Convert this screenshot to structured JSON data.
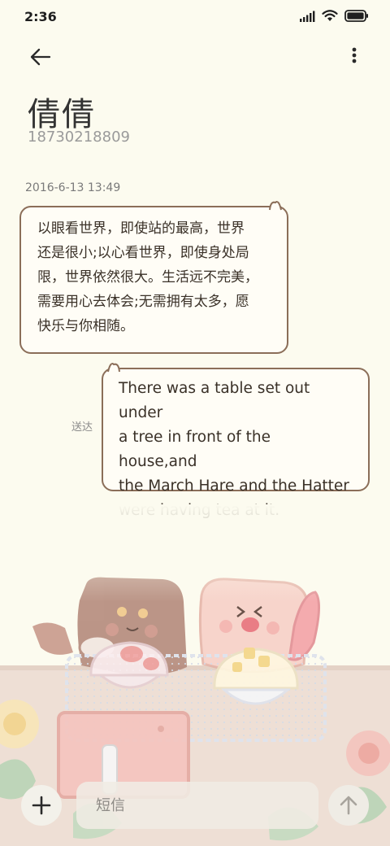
{
  "status_bar": {
    "time": "2:36",
    "icons": [
      "signal-icon",
      "wifi-icon",
      "battery-icon"
    ]
  },
  "header": {
    "back_icon": "arrow-left-icon",
    "more_icon": "more-vertical-icon"
  },
  "contact": {
    "name": "倩倩",
    "phone": "18730218809"
  },
  "conversation": {
    "timestamp": "2016-6-13 13:49",
    "messages": [
      {
        "direction": "incoming",
        "lines": [
          "以眼看世界，即使站的最高，世界",
          "还是很小;以心看世界，即使身处局",
          "限，世界依然很大。生活远不完美，",
          "需要用心去体会;无需拥有太多，愿",
          "快乐与你相随。"
        ]
      },
      {
        "direction": "outgoing",
        "status": "送达",
        "lines": [
          "There was a table set out under",
          "a tree in front of the house,and",
          "the March Hare and the Hatter",
          "were having tea at it."
        ]
      }
    ]
  },
  "composer": {
    "add_icon": "plus-icon",
    "placeholder": "短信",
    "send_icon": "arrow-up-icon"
  },
  "colors": {
    "background": "#fcfbef",
    "bubble_border": "#8b6e59",
    "bubble_fill": "#fffdf6"
  }
}
